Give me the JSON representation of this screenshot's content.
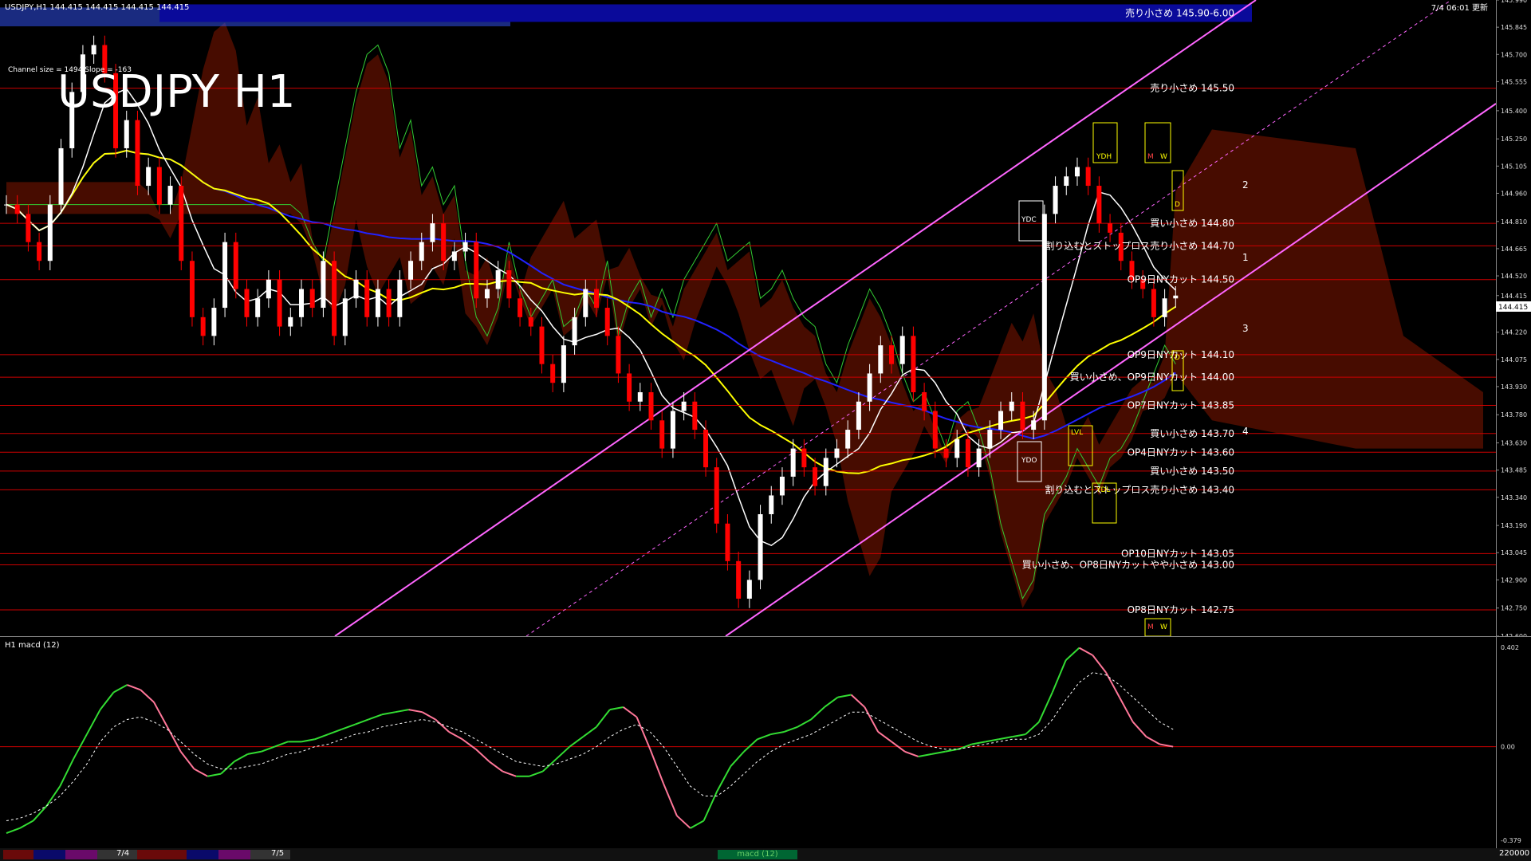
{
  "header": {
    "ohlc_text": "USDJPY,H1  144.415 144.415 144.415 144.415",
    "datetime_text": "7/4 06:01 更新",
    "channel_text": "Channel size = 1494 Slope = -163",
    "big_title": "USDJPY H1"
  },
  "colors": {
    "background": "#000000",
    "bull_candle": "#ffffff",
    "bear_candle": "#ff0000",
    "level_line": "#cc0000",
    "channel": "#ff66ff",
    "ma_white": "#ffffff",
    "ma_yellow": "#ffff00",
    "ma_blue": "#2222ff",
    "kumo_red": "#cc2200",
    "kumo_blue": "#3355ff",
    "chikou_green": "#33cc33",
    "macd_green": "#33dd33",
    "macd_pink": "#ff7799",
    "price_box_bg": "#ffffff"
  },
  "chart_data": [
    {
      "type": "candlestick",
      "symbol": "USDJPY",
      "timeframe": "H1",
      "ylim": [
        142.6,
        145.99
      ],
      "y_ticks": [
        "145.990",
        "145.845",
        "145.700",
        "145.555",
        "145.400",
        "145.250",
        "145.105",
        "144.960",
        "144.810",
        "144.665",
        "144.520",
        "144.415",
        "144.370",
        "144.220",
        "144.075",
        "143.930",
        "143.780",
        "143.630",
        "143.485",
        "143.340",
        "143.190",
        "143.045",
        "142.900",
        "142.750",
        "142.600"
      ],
      "current_price": 144.415,
      "current_price_label": "144.415",
      "close_path": [
        144.9,
        144.85,
        144.7,
        144.6,
        144.9,
        145.2,
        145.5,
        145.7,
        145.75,
        145.6,
        145.2,
        145.35,
        145.0,
        145.1,
        144.9,
        145.0,
        144.6,
        144.3,
        144.2,
        144.35,
        144.7,
        144.45,
        144.3,
        144.4,
        144.5,
        144.25,
        144.3,
        144.45,
        144.35,
        144.6,
        144.2,
        144.4,
        144.5,
        144.3,
        144.45,
        144.3,
        144.5,
        144.6,
        144.7,
        144.8,
        144.6,
        144.65,
        144.7,
        144.4,
        144.45,
        144.55,
        144.4,
        144.3,
        144.25,
        144.05,
        143.95,
        144.15,
        144.3,
        144.45,
        144.35,
        144.2,
        144.0,
        143.85,
        143.9,
        143.75,
        143.6,
        143.8,
        143.85,
        143.7,
        143.5,
        143.2,
        143.0,
        142.8,
        142.9,
        143.25,
        143.35,
        143.45,
        143.6,
        143.5,
        143.4,
        143.55,
        143.6,
        143.7,
        143.85,
        144.0,
        144.15,
        144.05,
        144.2,
        143.9,
        143.8,
        143.6,
        143.55,
        143.65,
        143.5,
        143.6,
        143.7,
        143.8,
        143.85,
        143.7,
        143.75,
        144.85,
        145.0,
        145.05,
        145.1,
        145.0,
        144.8,
        144.75,
        144.6,
        144.5,
        144.45,
        144.3,
        144.4,
        144.415
      ]
    },
    {
      "type": "line",
      "title": "H1 macd (12)",
      "ylim": [
        -0.379,
        0.402
      ],
      "y_ticks": [
        "0.402",
        "0.00",
        "-0.379"
      ],
      "series": [
        {
          "values": [
            -0.35,
            -0.33,
            -0.3,
            -0.24,
            -0.16,
            -0.05,
            0.05,
            0.15,
            0.22,
            0.25,
            0.23,
            0.18,
            0.08,
            -0.02,
            -0.09,
            -0.12,
            -0.11,
            -0.06,
            -0.03,
            -0.02,
            0.0,
            0.02,
            0.02,
            0.03,
            0.05,
            0.07,
            0.09,
            0.11,
            0.13,
            0.14,
            0.15,
            0.14,
            0.11,
            0.06,
            0.03,
            -0.01,
            -0.06,
            -0.1,
            -0.12,
            -0.12,
            -0.1,
            -0.05,
            0.0,
            0.04,
            0.08,
            0.15,
            0.16,
            0.12,
            -0.01,
            -0.15,
            -0.28,
            -0.33,
            -0.3,
            -0.18,
            -0.08,
            -0.02,
            0.03,
            0.05,
            0.06,
            0.08,
            0.11,
            0.16,
            0.2,
            0.21,
            0.16,
            0.06,
            0.02,
            -0.02,
            -0.04,
            -0.03,
            -0.02,
            -0.01,
            0.01,
            0.02,
            0.03,
            0.04,
            0.05,
            0.1,
            0.22,
            0.35,
            0.4,
            0.37,
            0.3,
            0.2,
            0.1,
            0.04,
            0.01,
            0.0
          ]
        },
        {
          "values": [
            -0.3,
            -0.29,
            -0.27,
            -0.24,
            -0.2,
            -0.14,
            -0.07,
            0.02,
            0.08,
            0.11,
            0.12,
            0.1,
            0.07,
            0.02,
            -0.03,
            -0.07,
            -0.09,
            -0.09,
            -0.08,
            -0.07,
            -0.05,
            -0.03,
            -0.02,
            0.0,
            0.01,
            0.03,
            0.05,
            0.06,
            0.08,
            0.09,
            0.1,
            0.11,
            0.1,
            0.08,
            0.06,
            0.03,
            0.0,
            -0.03,
            -0.06,
            -0.07,
            -0.08,
            -0.07,
            -0.05,
            -0.03,
            0.0,
            0.04,
            0.07,
            0.09,
            0.06,
            0.0,
            -0.08,
            -0.16,
            -0.2,
            -0.2,
            -0.16,
            -0.11,
            -0.06,
            -0.02,
            0.01,
            0.03,
            0.05,
            0.08,
            0.11,
            0.14,
            0.14,
            0.11,
            0.08,
            0.05,
            0.02,
            0.0,
            -0.01,
            -0.01,
            0.0,
            0.01,
            0.02,
            0.03,
            0.03,
            0.05,
            0.11,
            0.19,
            0.26,
            0.3,
            0.29,
            0.25,
            0.2,
            0.15,
            0.1,
            0.07
          ]
        }
      ]
    }
  ],
  "levels": [
    {
      "label": "売り小さめ 145.90-6.00",
      "price": 145.92,
      "boxed": true
    },
    {
      "label": "売り小さめ 145.50",
      "price": 145.52
    },
    {
      "label": "買い小さめ 144.80",
      "price": 144.8
    },
    {
      "label": "割り込むとストップロス売り小さめ 144.70",
      "price": 144.68
    },
    {
      "label": "OP9日NYカット 144.50",
      "price": 144.5
    },
    {
      "label": "OP9日NYカット 144.10",
      "price": 144.1
    },
    {
      "label": "買い小さめ、OP9日NYカット 144.00",
      "price": 143.98
    },
    {
      "label": "OP7日NYカット 143.85",
      "price": 143.83
    },
    {
      "label": "買い小さめ 143.70",
      "price": 143.68
    },
    {
      "label": "OP4日NYカット 143.60",
      "price": 143.58
    },
    {
      "label": "買い小さめ 143.50",
      "price": 143.48
    },
    {
      "label": "割り込むとストップロス売り小さめ 143.40",
      "price": 143.38
    },
    {
      "label": "OP10日NYカット 143.05",
      "price": 143.04
    },
    {
      "label": "買い小さめ、OP8日NYカットやや小さめ 143.00",
      "price": 142.98
    },
    {
      "label": "OP8日NYカット 142.75",
      "price": 142.74
    }
  ],
  "boxes": {
    "ydh": "YDH",
    "ydc": "YDC",
    "ydo": "YDO",
    "ydl": "YDL",
    "lvl": "LVL",
    "m": "M",
    "w": "W",
    "d": "D"
  },
  "wave_numbers": [
    "1",
    "2",
    "3",
    "4"
  ],
  "bottom_bar": {
    "date1": "7/4",
    "date2": "7/5",
    "macd_tab": "macd (12)",
    "right_value": "220000"
  }
}
